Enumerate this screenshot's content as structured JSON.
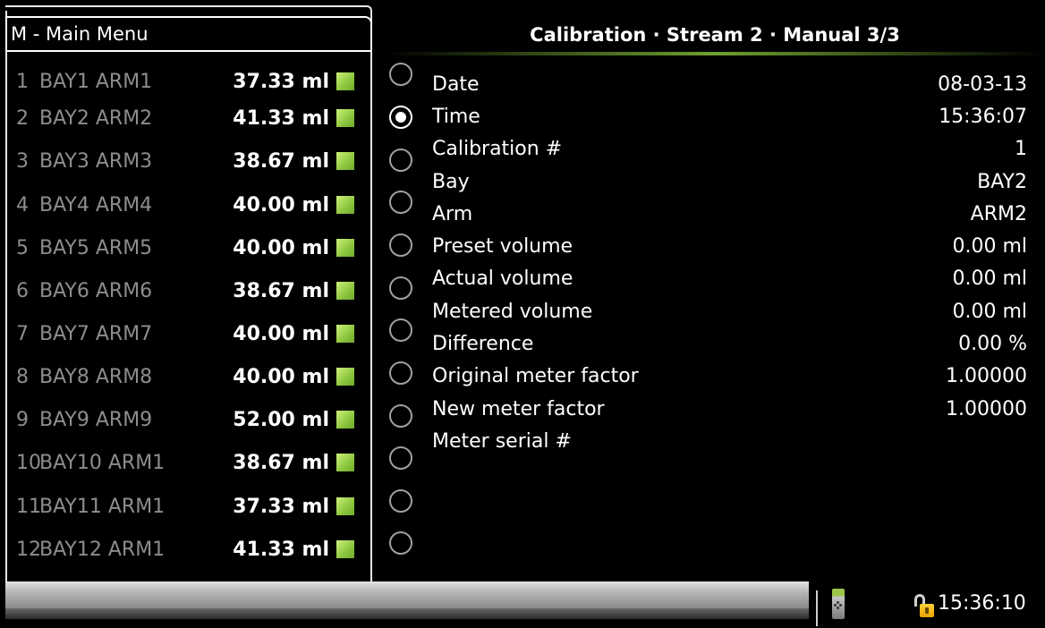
{
  "menu": {
    "header": "M - Main Menu",
    "items": [
      {
        "num": "1",
        "name": "BAY1 ARM1",
        "volume": "37.33 ml"
      },
      {
        "num": "2",
        "name": "BAY2 ARM2",
        "volume": "41.33 ml"
      },
      {
        "num": "3",
        "name": "BAY3 ARM3",
        "volume": "38.67 ml"
      },
      {
        "num": "4",
        "name": "BAY4 ARM4",
        "volume": "40.00 ml"
      },
      {
        "num": "5",
        "name": "BAY5 ARM5",
        "volume": "40.00 ml"
      },
      {
        "num": "6",
        "name": "BAY6 ARM6",
        "volume": "38.67 ml"
      },
      {
        "num": "7",
        "name": "BAY7 ARM7",
        "volume": "40.00 ml"
      },
      {
        "num": "8",
        "name": "BAY8 ARM8",
        "volume": "40.00 ml"
      },
      {
        "num": "9",
        "name": "BAY9 ARM9",
        "volume": "52.00 ml"
      },
      {
        "num": "10",
        "name": "BAY10 ARM1",
        "volume": "38.67 ml"
      },
      {
        "num": "11",
        "name": "BAY11 ARM1",
        "volume": "37.33 ml"
      },
      {
        "num": "12",
        "name": "BAY12 ARM1",
        "volume": "41.33 ml"
      }
    ],
    "status_color": "#8cc63e"
  },
  "detail": {
    "title": "Calibration · Stream 2 · Manual 3/3",
    "selected_index": 1,
    "fields": [
      {
        "label": "Date",
        "value": "08-03-13"
      },
      {
        "label": "Time",
        "value": "15:36:07"
      },
      {
        "label": "Calibration #",
        "value": "1"
      },
      {
        "label": "Bay",
        "value": "BAY2"
      },
      {
        "label": "Arm",
        "value": "ARM2"
      },
      {
        "label": "Preset volume",
        "value": "0.00 ml"
      },
      {
        "label": "Actual volume",
        "value": "0.00 ml"
      },
      {
        "label": "Metered volume",
        "value": "0.00 ml"
      },
      {
        "label": "Difference",
        "value": "0.00 %"
      },
      {
        "label": "Original meter factor",
        "value": "1.00000"
      },
      {
        "label": "New meter factor",
        "value": "1.00000"
      },
      {
        "label": "Meter serial #",
        "value": ""
      }
    ]
  },
  "status_bar": {
    "clock": "15:36:10",
    "icons": [
      "device-icon",
      "lock-icon"
    ]
  }
}
